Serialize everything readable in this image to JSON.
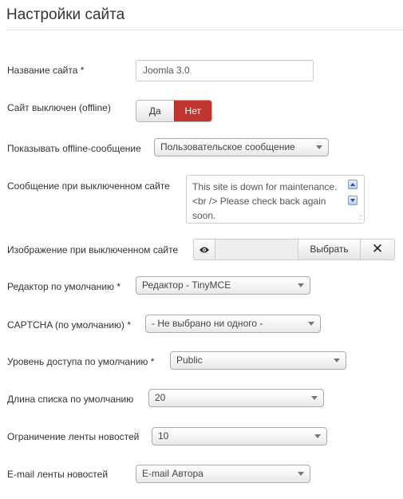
{
  "page": {
    "title": "Настройки сайта"
  },
  "fields": {
    "sitename": {
      "label": "Название сайта *",
      "value": "Joomla 3.0"
    },
    "offline": {
      "label": "Сайт выключен (offline)",
      "options": [
        "Да",
        "Нет"
      ],
      "selected": "Нет"
    },
    "offline_message_type": {
      "label": "Показывать offline-сообщение",
      "value": "Пользовательское сообщение"
    },
    "offline_message": {
      "label": "Сообщение при выключенном сайте",
      "value": "This site is down for maintenance.<br /> Please check back again soon."
    },
    "offline_image": {
      "label": "Изображение при выключенном сайте",
      "select_label": "Выбрать",
      "clear_symbol": "✕"
    },
    "editor": {
      "label": "Редактор по умолчанию *",
      "value": "Редактор - TinyMCE"
    },
    "captcha": {
      "label": "CAPTCHA (по умолчанию) *",
      "value": "- Не выбрано ни одного -"
    },
    "access": {
      "label": "Уровень доступа по умолчанию *",
      "value": "Public"
    },
    "list_limit": {
      "label": "Длина списка по умолчанию",
      "value": "20"
    },
    "feed_limit": {
      "label": "Ограничение ленты новостей",
      "value": "10"
    },
    "feed_email": {
      "label": "E-mail ленты новостей",
      "value": "E-mail Автора"
    }
  },
  "colors": {
    "toggle_active": "#bd362f"
  }
}
